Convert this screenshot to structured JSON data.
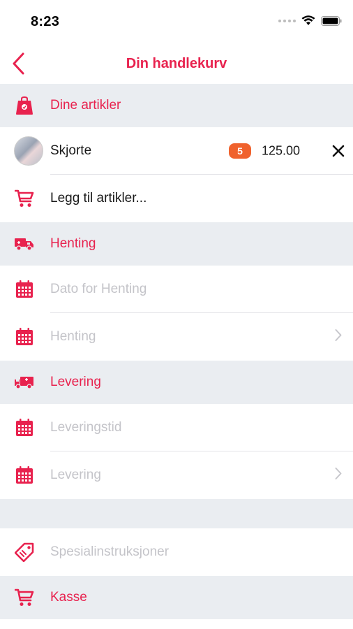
{
  "status": {
    "time": "8:23"
  },
  "nav": {
    "title": "Din handlekurv"
  },
  "sections": {
    "articles": {
      "title": "Dine artikler"
    },
    "pickup": {
      "title": "Henting"
    },
    "delivery": {
      "title": "Levering"
    },
    "checkout": {
      "title": "Kasse"
    }
  },
  "cart_item": {
    "name": "Skjorte",
    "quantity": "5",
    "price": "125.00"
  },
  "add_items": {
    "label": "Legg til artikler..."
  },
  "pickup_rows": {
    "date_placeholder": "Dato for Henting",
    "time_placeholder": "Henting"
  },
  "delivery_rows": {
    "time_placeholder": "Leveringstid",
    "date_placeholder": "Levering"
  },
  "special": {
    "placeholder": "Spesialinstruksjoner"
  },
  "colors": {
    "accent": "#e8224e",
    "badge": "#f0622d",
    "section_bg": "#eaedf1",
    "placeholder": "#c4c4c9"
  }
}
